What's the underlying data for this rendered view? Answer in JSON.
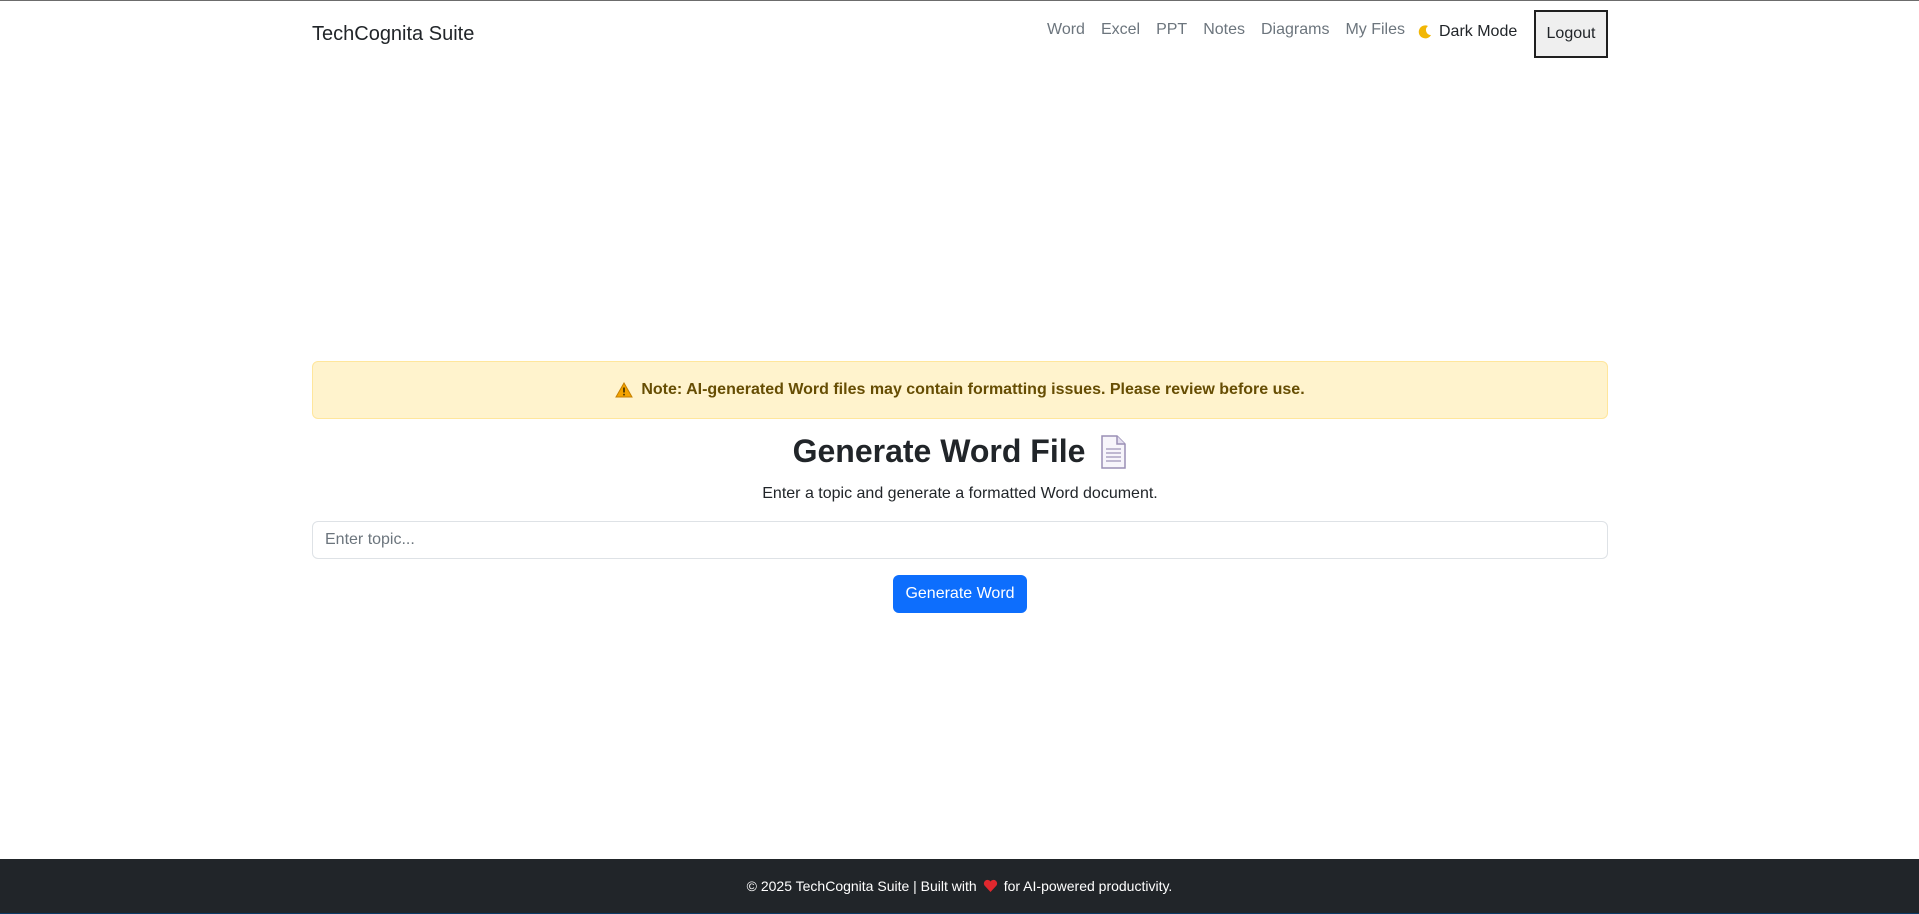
{
  "navbar": {
    "brand": "TechCognita Suite",
    "links": [
      {
        "label": "Word"
      },
      {
        "label": "Excel"
      },
      {
        "label": "PPT"
      },
      {
        "label": "Notes"
      },
      {
        "label": "Diagrams"
      },
      {
        "label": "My Files"
      }
    ],
    "dark_mode_label": "Dark Mode",
    "dark_mode_icon": "moon-icon",
    "logout_label": "Logout"
  },
  "warning": {
    "icon": "warning-icon",
    "text": "Note: AI-generated Word files may contain formatting issues. Please review before use."
  },
  "main": {
    "title": "Generate Word File",
    "title_icon": "document-icon",
    "subtitle": "Enter a topic and generate a formatted Word document.",
    "topic_input": {
      "placeholder": "Enter topic...",
      "value": ""
    },
    "generate_label": "Generate Word"
  },
  "footer": {
    "text_before": "© 2025 TechCognita Suite | Built with",
    "icon": "heart-icon",
    "text_after": "for AI-powered productivity."
  },
  "colors": {
    "primary": "#0d6efd",
    "warning_bg": "#fff3cd",
    "warning_text": "#664d03",
    "footer_bg": "#212529"
  }
}
